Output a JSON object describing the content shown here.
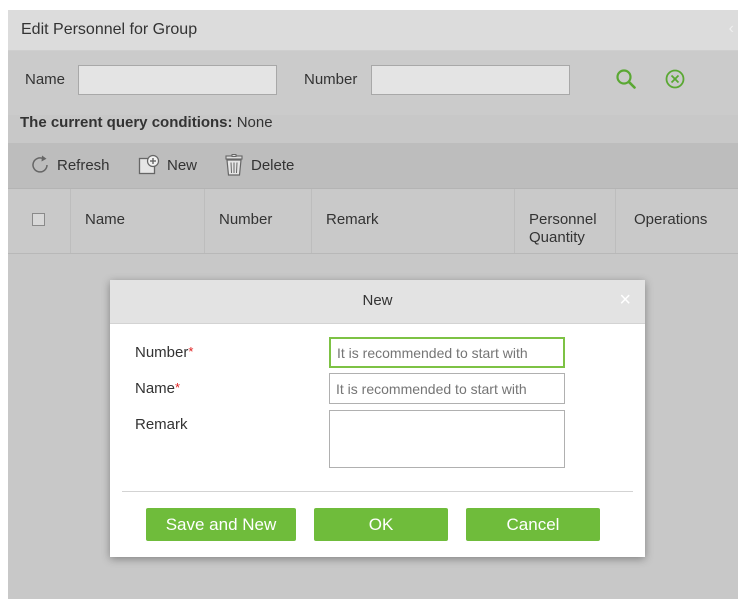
{
  "panel": {
    "title": "Edit Personnel for Group",
    "collapse_icon": "chevron-left-icon"
  },
  "search": {
    "name_label": "Name",
    "name_value": "",
    "number_label": "Number",
    "number_value": "",
    "search_icon": "search-icon",
    "clear_icon": "clear-circle-icon"
  },
  "query": {
    "prefix": "The current query conditions:",
    "value": "None"
  },
  "toolbar": {
    "refresh_label": "Refresh",
    "new_label": "New",
    "delete_label": "Delete"
  },
  "table": {
    "columns": [
      "Name",
      "Number",
      "Remark",
      "Personnel Quantity",
      "Operations"
    ],
    "personnel_quantity_lines": [
      "Personnel",
      "Quantity"
    ],
    "rows": []
  },
  "modal": {
    "title": "New",
    "close_glyph": "×",
    "number_label": "Number",
    "name_label": "Name",
    "remark_label": "Remark",
    "required_mark": "*",
    "number_placeholder": "It is recommended to start with",
    "name_placeholder": "It is recommended to start with",
    "remark_value": "",
    "save_and_new_label": "Save and New",
    "ok_label": "OK",
    "cancel_label": "Cancel"
  },
  "colors": {
    "accent_green": "#6fbc3b",
    "focus_green": "#7dc244",
    "required_red": "#e02020"
  }
}
